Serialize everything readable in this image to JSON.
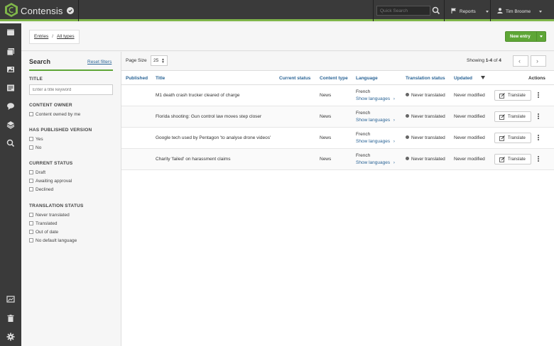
{
  "app": {
    "brand": "Contensis",
    "quick_search_placeholder": "Quick Search",
    "reports_label": "Reports",
    "user_name": "Tim Broome",
    "accent_color": "#7fb54a"
  },
  "breadcrumb": {
    "items": [
      "Entries",
      "All types"
    ],
    "separator": "/"
  },
  "new_entry_label": "New entry",
  "search": {
    "title": "Search",
    "reset_label": "Reset filters",
    "title_section": "TITLE",
    "title_placeholder": "Enter a title keyword",
    "content_owner_section": "CONTENT OWNER",
    "content_owner_options": [
      "Content owned by me"
    ],
    "published_section": "HAS PUBLISHED VERSION",
    "published_options": [
      "Yes",
      "No"
    ],
    "status_section": "CURRENT STATUS",
    "status_options": [
      "Draft",
      "Awaiting approval",
      "Declined"
    ],
    "translation_section": "TRANSLATION STATUS",
    "translation_options": [
      "Never translated",
      "Translated",
      "Out of date",
      "No default language"
    ]
  },
  "results": {
    "page_size_label": "Page Size",
    "page_size_value": "25",
    "showing_prefix": "Showing",
    "showing_range": "1-4",
    "showing_of": "of",
    "showing_total": "4",
    "columns": {
      "published": "Published",
      "title": "Title",
      "current_status": "Current status",
      "content_type": "Content type",
      "language": "Language",
      "translation_status": "Translation status",
      "updated": "Updated",
      "actions": "Actions"
    },
    "show_languages_label": "Show languages",
    "translate_label": "Translate",
    "rows": [
      {
        "title": "M1 death crash trucker cleared of charge",
        "content_type": "News",
        "language": "French",
        "translation_status": "Never translated",
        "updated": "Never modified"
      },
      {
        "title": "Florida shooting: Gun control law moves step closer",
        "content_type": "News",
        "language": "French",
        "translation_status": "Never translated",
        "updated": "Never modified"
      },
      {
        "title": "Google tech used by Pentagon 'to analyse drone videos'",
        "content_type": "News",
        "language": "French",
        "translation_status": "Never translated",
        "updated": "Never modified"
      },
      {
        "title": "Charity 'failed' on harassment claims",
        "content_type": "News",
        "language": "French",
        "translation_status": "Never translated",
        "updated": "Never modified"
      }
    ]
  }
}
